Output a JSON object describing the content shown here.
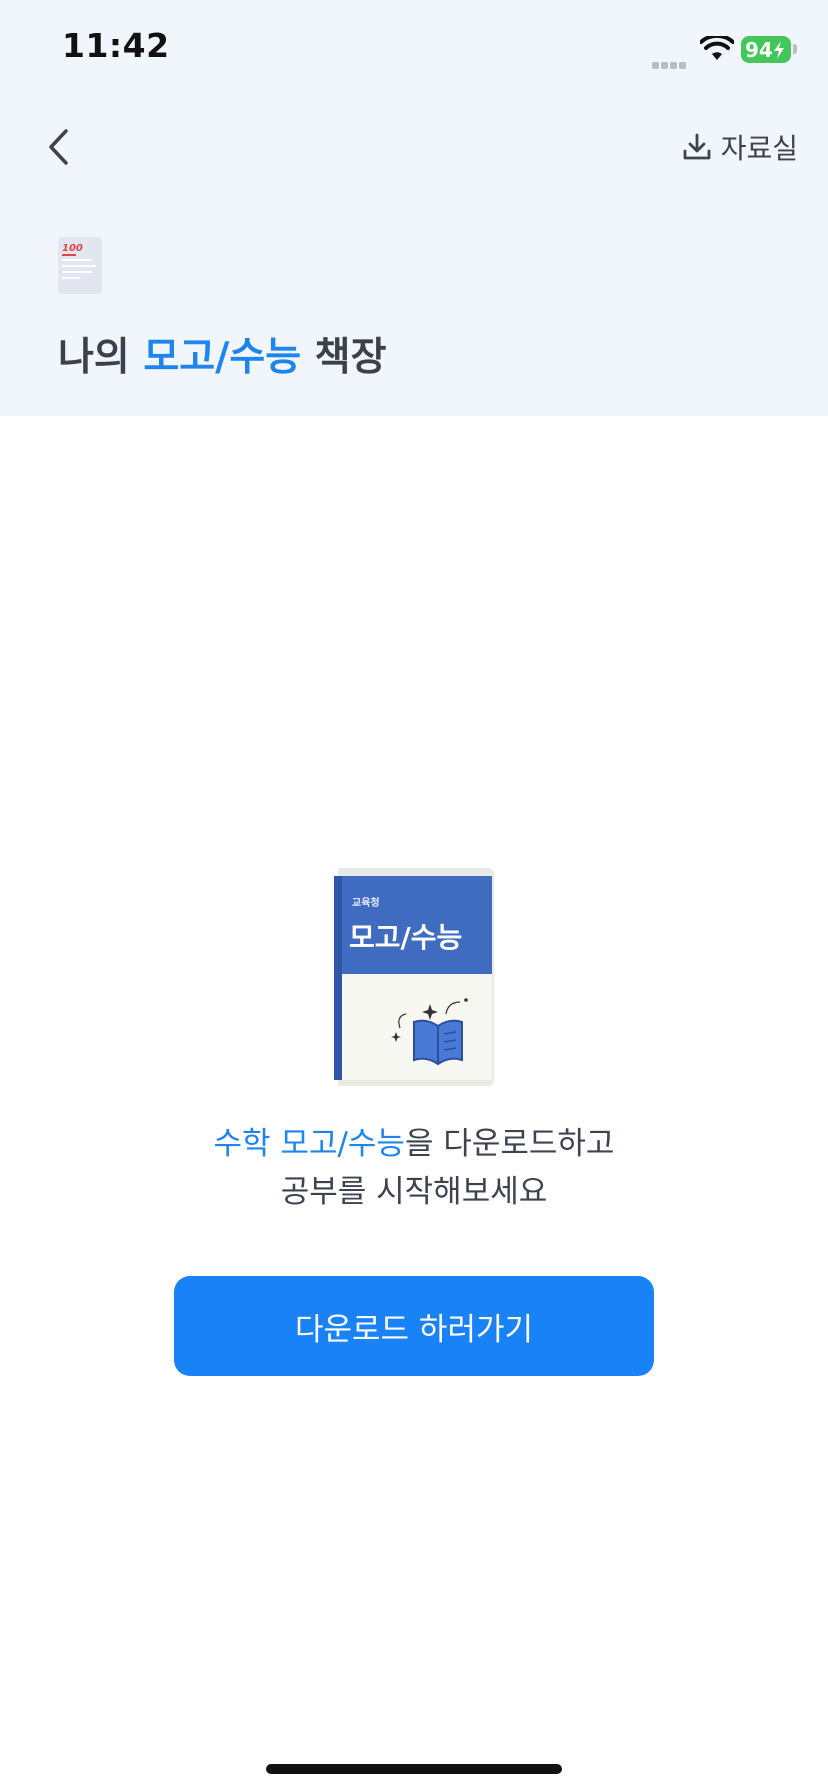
{
  "status_bar": {
    "time": "11:42",
    "battery": "94"
  },
  "nav": {
    "archive_label": "자료실",
    "back_icon": "chevron-left-icon",
    "archive_icon": "download-icon"
  },
  "header": {
    "title_prefix": "나의 ",
    "title_highlight": "모고/수능",
    "title_suffix": " 책장",
    "badge_text": "100"
  },
  "illustration": {
    "publisher": "교육청",
    "book_title": "모고/수능"
  },
  "message": {
    "highlight": "수학 모고/수능",
    "line1_rest": "을 다운로드하고",
    "line2": "공부를 시작해보세요"
  },
  "cta": {
    "label": "다운로드 하러가기"
  },
  "colors": {
    "accent": "#1a82f7",
    "highlight_text": "#1f84ec",
    "header_bg": "#f1f5fc"
  }
}
